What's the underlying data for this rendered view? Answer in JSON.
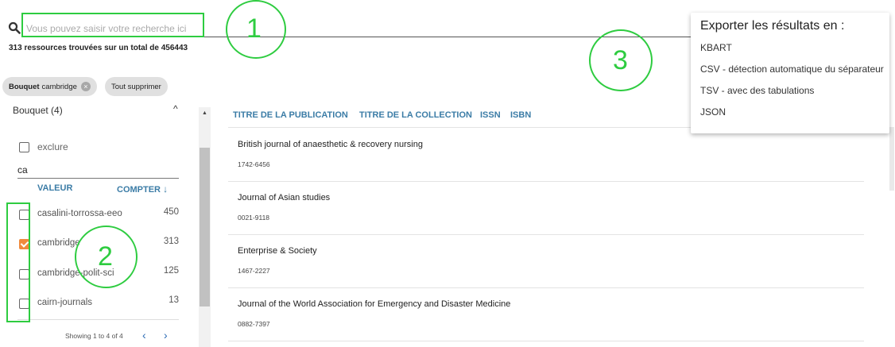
{
  "search": {
    "placeholder": "Vous pouvez saisir votre recherche ici",
    "result_count": "313 ressources trouvées sur un total de 456443"
  },
  "chips": {
    "bouquet_label": "Bouquet",
    "bouquet_value": "cambridge",
    "clear_all": "Tout supprimer"
  },
  "facet": {
    "title": "Bouquet (4)",
    "exclude_label": "exclure",
    "filter_value": "ca",
    "col_value": "VALEUR",
    "col_count": "COMPTER",
    "items": [
      {
        "label": "casalini-torrossa-eeo",
        "count": "450",
        "checked": false
      },
      {
        "label": "cambridge",
        "count": "313",
        "checked": true
      },
      {
        "label": "cambridge-polit-sci",
        "count": "125",
        "checked": false
      },
      {
        "label": "cairn-journals",
        "count": "13",
        "checked": false
      }
    ],
    "pager_text": "Showing 1 to 4 of 4",
    "prev": "‹",
    "next": "›"
  },
  "results": {
    "columns": [
      "TITRE DE LA PUBLICATION",
      "TITRE DE LA COLLECTION",
      "ISSN",
      "ISBN"
    ],
    "rows": [
      {
        "title": "British journal of anaesthetic & recovery nursing",
        "issn": "1742-6456"
      },
      {
        "title": "Journal of Asian studies",
        "issn": "0021-9118"
      },
      {
        "title": "Enterprise & Society",
        "issn": "1467-2227"
      },
      {
        "title": "Journal of the World Association for Emergency and Disaster Medicine",
        "issn": "0882-7397"
      }
    ]
  },
  "export": {
    "title": "Exporter les résultats en :",
    "options": [
      "KBART",
      "CSV - détection automatique du séparateur",
      "TSV - avec des tabulations",
      "JSON"
    ]
  },
  "annotations": {
    "one": "1",
    "two": "2",
    "three": "3",
    "color": "#2ecc40"
  },
  "colors": {
    "accent": "#3b7ca6",
    "checkbox_checked": "#f08a3c",
    "pager": "#2a6ab4"
  }
}
